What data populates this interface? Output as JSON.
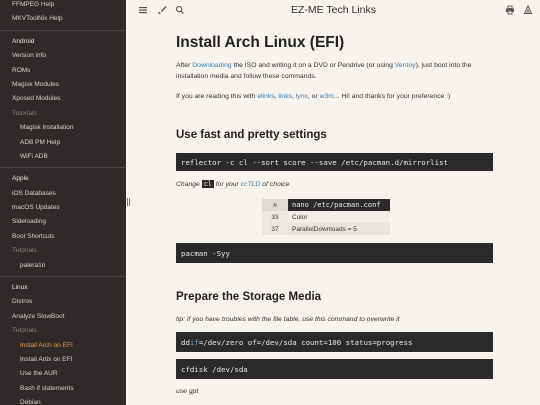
{
  "sidebar": {
    "items": [
      {
        "label": "FFMPEG Help",
        "kind": "d1"
      },
      {
        "label": "MKVToolNix Help",
        "kind": "d1"
      },
      {
        "label": "",
        "kind": "sep"
      },
      {
        "label": "Android",
        "kind": "sec"
      },
      {
        "label": "Version info",
        "kind": "d1"
      },
      {
        "label": "ROMs",
        "kind": "d1"
      },
      {
        "label": "Magisk Modules",
        "kind": "d1"
      },
      {
        "label": "Xposed Modules",
        "kind": "d1"
      },
      {
        "label": "Tutorials",
        "kind": "cat"
      },
      {
        "label": "Magisk Installation",
        "kind": "d2"
      },
      {
        "label": "ADB PM Help",
        "kind": "d2"
      },
      {
        "label": "WiFi ADB",
        "kind": "d2"
      },
      {
        "label": "",
        "kind": "sep"
      },
      {
        "label": "Apple",
        "kind": "sec"
      },
      {
        "label": "iOS Databases",
        "kind": "d1"
      },
      {
        "label": "macOS Updates",
        "kind": "d1"
      },
      {
        "label": "Sideloading",
        "kind": "d1"
      },
      {
        "label": "Boot Shortcuts",
        "kind": "d1"
      },
      {
        "label": "Tutorials",
        "kind": "cat"
      },
      {
        "label": "palera1n",
        "kind": "d2"
      },
      {
        "label": "",
        "kind": "sep"
      },
      {
        "label": "Linux",
        "kind": "sec"
      },
      {
        "label": "Distros",
        "kind": "d1"
      },
      {
        "label": "Analyze SlowBoot",
        "kind": "d1"
      },
      {
        "label": "Tutorials",
        "kind": "cat"
      },
      {
        "label": "Install Arch on EFI",
        "kind": "d2 active"
      },
      {
        "label": "Install Artix on EFI",
        "kind": "d2"
      },
      {
        "label": "Use the AUR",
        "kind": "d2"
      },
      {
        "label": "Bash if statements",
        "kind": "d2"
      },
      {
        "label": "Debian",
        "kind": "d2"
      }
    ]
  },
  "topbar": {
    "title": "EZ-ME Tech Links",
    "icons": [
      "menu-icon",
      "brush-icon",
      "search-icon",
      "print-icon",
      "github-icon"
    ]
  },
  "page": {
    "title": "Install Arch Linux (EFI)",
    "intro": {
      "t1": "After ",
      "link1": "Downloading",
      "t2": " the ISO and writing it on a DVD or Pendrive (or using ",
      "link2": "Ventoy",
      "t3": "), just boot into the installation media and follow these commands."
    },
    "browsers": {
      "t1": "If you are reading this with ",
      "l1": "elinks",
      "s1": ", ",
      "l2": "links",
      "s2": ", ",
      "l3": "lynx",
      "s3": ", or ",
      "l4": "w3m",
      "t2": "... Hi! and thanks for your preference :)"
    },
    "section1": "Use fast and pretty settings",
    "cmd_reflector": "reflector -c cl --sort score --save /etc/pacman.d/mirrorlist",
    "change_note": {
      "t1": "Change ",
      "code": "cl",
      "t2": " for your ",
      "link": "ccTLD",
      "t3": " of choice"
    },
    "table": {
      "head_num": "#",
      "head_file": "nano /etc/pacman.conf",
      "rows": [
        {
          "num": "33",
          "val": "Color"
        },
        {
          "num": "37",
          "val": "ParallelDownloads = 5"
        }
      ]
    },
    "cmd_pacman": "pacman -Syy",
    "section2": "Prepare the Storage Media",
    "tip": "tip: if you have troubles with the file table, use this command to overwrite it",
    "cmd_dd": {
      "kw": "if",
      "pre": "dd ",
      "post": "=/dev/zero of=/dev/sda count=100 status=progress"
    },
    "cmd_cfdisk": "cfdisk /dev/sda",
    "use_gpt": "use gpt"
  }
}
